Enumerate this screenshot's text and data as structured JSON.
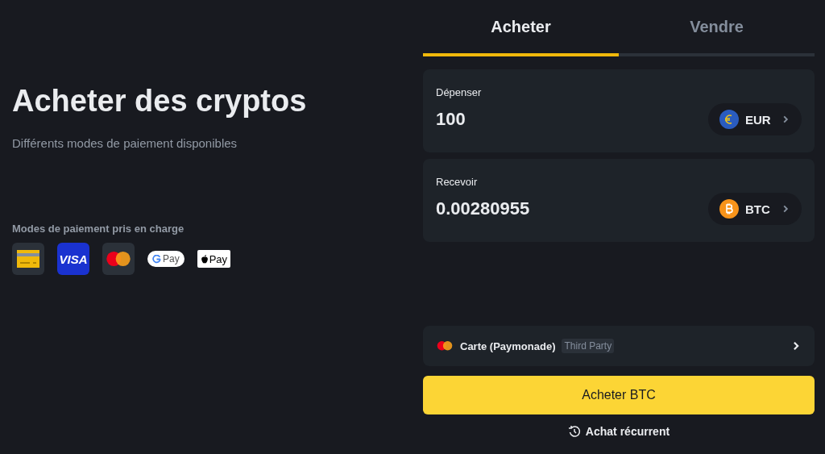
{
  "hero": {
    "title": "Acheter des cryptos",
    "subtitle": "Différents modes de paiement disponibles"
  },
  "payment_methods": {
    "label": "Modes de paiement pris en charge",
    "items": [
      {
        "kind": "card"
      },
      {
        "kind": "visa",
        "text": "VISA"
      },
      {
        "kind": "mastercard"
      },
      {
        "kind": "gpay",
        "text": "Pay"
      },
      {
        "kind": "applepay",
        "text": "Pay"
      }
    ]
  },
  "tabs": [
    {
      "label": "Acheter",
      "selected": true
    },
    {
      "label": "Vendre",
      "selected": false
    }
  ],
  "fields": [
    {
      "label": "Dépenser",
      "value": "100",
      "currency": "EUR",
      "kind": "eur"
    },
    {
      "label": "Recevoir",
      "value": "0.00280955",
      "currency": "BTC",
      "kind": "btc"
    }
  ],
  "payment": {
    "name": "Carte (Paymonade)",
    "badge": "Third Party"
  },
  "buy_button": "Acheter BTC",
  "recurring": "Achat récurrent"
}
